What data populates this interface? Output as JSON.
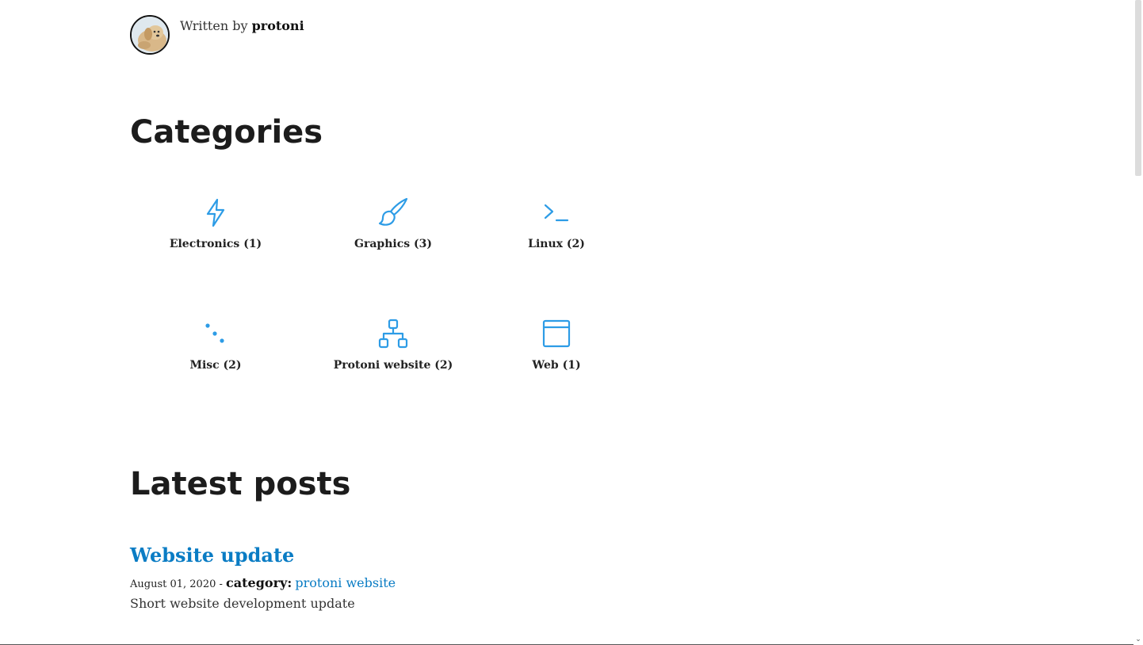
{
  "author": {
    "prefix": "Written by ",
    "name": "protoni",
    "avatar_icon": "dog-avatar-icon"
  },
  "categories": {
    "heading": "Categories",
    "accent_color": "#2d9ce6",
    "items": [
      {
        "label": "Electronics (1)",
        "icon": "lightning-bolt-icon"
      },
      {
        "label": "Graphics (3)",
        "icon": "paint-brush-icon"
      },
      {
        "label": "Linux (2)",
        "icon": "terminal-prompt-icon"
      },
      {
        "label": "Misc (2)",
        "icon": "dots-icon"
      },
      {
        "label": "Protoni website (2)",
        "icon": "sitemap-icon"
      },
      {
        "label": "Web (1)",
        "icon": "browser-window-icon"
      }
    ]
  },
  "latest_posts": {
    "heading": "Latest posts",
    "posts": [
      {
        "title": "Website update",
        "date": "August 01, 2020",
        "separator": " - ",
        "category_key": "category:",
        "category_value": "protoni website",
        "summary": "Short website development update"
      }
    ]
  },
  "colors": {
    "link": "#0a7cc4",
    "heading": "#1c1c1c"
  }
}
